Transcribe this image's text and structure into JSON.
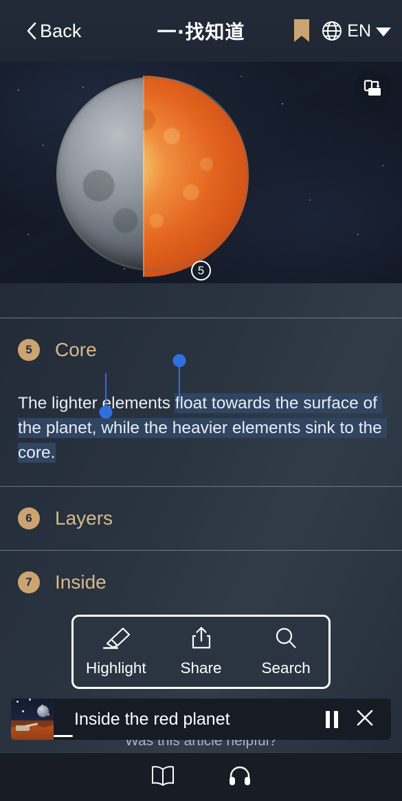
{
  "header": {
    "back_label": "Back",
    "title": "一·找知道",
    "lang_label": "EN",
    "bookmark_icon": "bookmark-icon",
    "globe_icon": "globe-icon",
    "chevron_icon": "chevron-down-icon"
  },
  "hero": {
    "marker_number": "5",
    "rotate_icon": "rotate-screen-icon",
    "alt": "Cutaway illustration of a planet showing a hot orange interior and core"
  },
  "sections": [
    {
      "number": "5",
      "title": "Core"
    },
    {
      "number": "6",
      "title": "Layers"
    },
    {
      "number": "7",
      "title": "Inside"
    }
  ],
  "paragraph": {
    "before_selection": "The lighter elements ",
    "selected": "float towards the surface of the planet, while the heavier elements sink to the core.",
    "full": "The lighter elements float towards the surface of the planet, while the heavier elements sink to the core."
  },
  "context_menu": {
    "items": [
      {
        "label": "Highlight",
        "icon": "highlighter-icon"
      },
      {
        "label": "Share",
        "icon": "share-icon"
      },
      {
        "label": "Search",
        "icon": "search-icon"
      }
    ]
  },
  "feedback": {
    "question": "Was this article helpful?"
  },
  "player": {
    "title": "Inside the red planet",
    "pause_icon": "pause-icon",
    "close_icon": "close-icon",
    "thumbnail": "article-thumbnail"
  },
  "bottom_nav": {
    "items": [
      {
        "icon": "book-icon",
        "name": "read"
      },
      {
        "icon": "headphones-icon",
        "name": "listen"
      }
    ]
  },
  "colors": {
    "accent_gold": "#CBA472",
    "section_title": "#D9B98A",
    "selection_blue": "#2F6FE0",
    "selection_fill": "#2F4561",
    "background": "#2A3440",
    "player_bg": "#161B24"
  }
}
